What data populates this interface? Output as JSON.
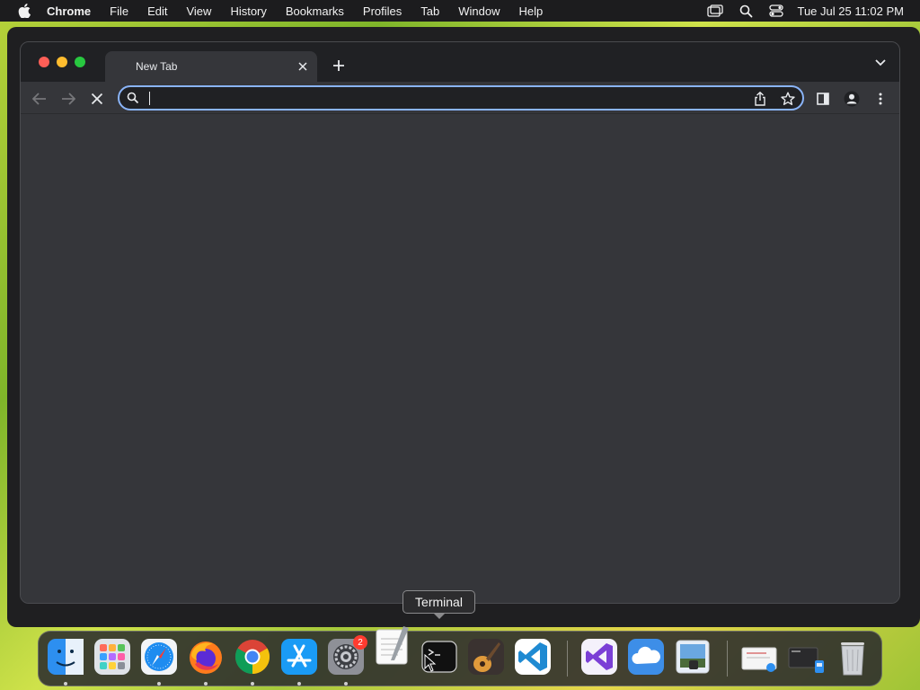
{
  "menubar": {
    "app_name": "Chrome",
    "items": [
      "File",
      "Edit",
      "View",
      "History",
      "Bookmarks",
      "Profiles",
      "Tab",
      "Window",
      "Help"
    ],
    "clock": "Tue Jul 25  11:02 PM"
  },
  "browser": {
    "tab_title": "New Tab",
    "omnibox_value": "",
    "omnibox_focus_color": "#8ab4f8"
  },
  "tooltip": {
    "text": "Terminal"
  },
  "dock": {
    "apps": [
      "Finder",
      "Launchpad",
      "Safari",
      "Firefox",
      "Chrome",
      "App Store",
      "System Settings",
      "TextEdit",
      "Terminal",
      "GarageBand",
      "Visual Studio Code",
      "Visual Studio",
      "iCloud",
      "Preview",
      "Documents",
      "Downloads",
      "Trash"
    ],
    "system_settings_badge": "2"
  },
  "colors": {
    "menubar_bg": "#1c1c1e",
    "tabstrip_bg": "#202124",
    "toolbar_bg": "#35363a",
    "accent": "#8ab4f8"
  }
}
